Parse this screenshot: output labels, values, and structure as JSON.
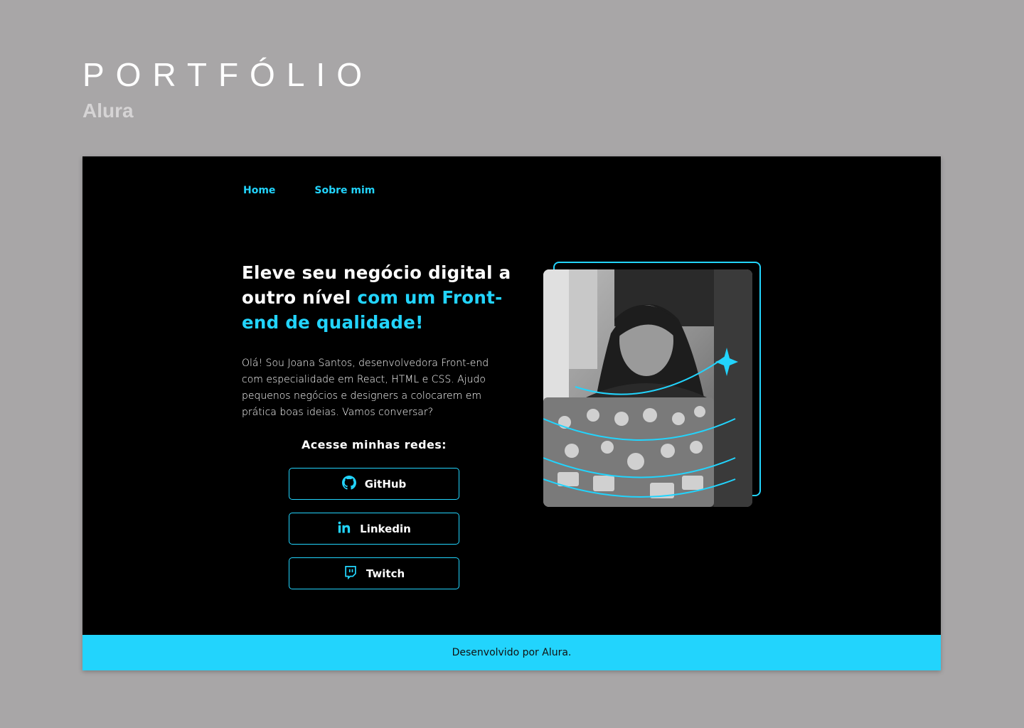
{
  "header": {
    "title": "PORTFÓLIO",
    "subtitle": "Alura"
  },
  "nav": {
    "items": [
      {
        "label": "Home"
      },
      {
        "label": "Sobre mim"
      }
    ]
  },
  "hero": {
    "title_white": "Eleve seu negócio digital a outro nível ",
    "title_accent": "com um Front-end de qualidade!",
    "description": "Olá! Sou Joana Santos, desenvolvedora Front-end com especialidade em React, HTML e CSS. Ajudo pequenos negócios e designers a colocarem em prática boas ideias. Vamos conversar?"
  },
  "social": {
    "title": "Acesse minhas redes:",
    "buttons": [
      {
        "label": "GitHub",
        "icon": "github-icon"
      },
      {
        "label": "Linkedin",
        "icon": "linkedin-icon"
      },
      {
        "label": "Twitch",
        "icon": "twitch-icon"
      }
    ]
  },
  "footer": {
    "text": "Desenvolvido por Alura."
  },
  "colors": {
    "accent": "#22d4fd",
    "background": "#000000",
    "canvas": "#a8a6a7"
  }
}
